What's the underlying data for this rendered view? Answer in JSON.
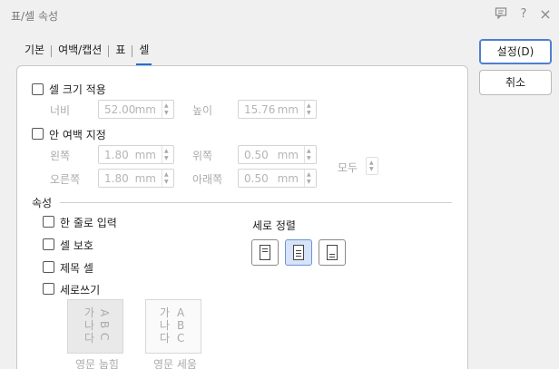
{
  "window": {
    "title": "표/셀 속성"
  },
  "titlebar_icons": [
    "comment-icon",
    "help-icon",
    "close-icon"
  ],
  "titlebar_text": {
    "help": "?",
    "close": "×"
  },
  "tabs": [
    {
      "label": "기본",
      "active": false
    },
    {
      "label": "여백/캡션",
      "active": false
    },
    {
      "label": "표",
      "active": false
    },
    {
      "label": "셀",
      "active": true
    }
  ],
  "buttons": {
    "ok": "설정(D)",
    "cancel": "취소"
  },
  "cell_size": {
    "checkbox_label": "셀 크기 적용",
    "width_label": "너비",
    "width_value": "52.00",
    "width_unit": "mm",
    "height_label": "높이",
    "height_value": "15.76",
    "height_unit": "mm"
  },
  "padding": {
    "checkbox_label": "안 여백 지정",
    "left_label": "왼쪽",
    "left_value": "1.80",
    "left_unit": "mm",
    "top_label": "위쪽",
    "top_value": "0.50",
    "top_unit": "mm",
    "right_label": "오른쪽",
    "right_value": "1.80",
    "right_unit": "mm",
    "bottom_label": "아래쪽",
    "bottom_value": "0.50",
    "bottom_unit": "mm",
    "all_label": "모두"
  },
  "properties": {
    "section_label": "속성",
    "single_line": "한 줄로 입력",
    "protect": "셀 보호",
    "header_cell": "제목 셀",
    "vertical_writing": "세로쓰기"
  },
  "vertical_align": {
    "label": "세로 정렬",
    "selected": "center"
  },
  "text_direction": {
    "rotated_label": "영문 눕힘",
    "upright_label": "영문 세움",
    "sample_hangul": [
      "가",
      "나",
      "다"
    ],
    "sample_latin": [
      "A",
      "B",
      "C"
    ]
  }
}
